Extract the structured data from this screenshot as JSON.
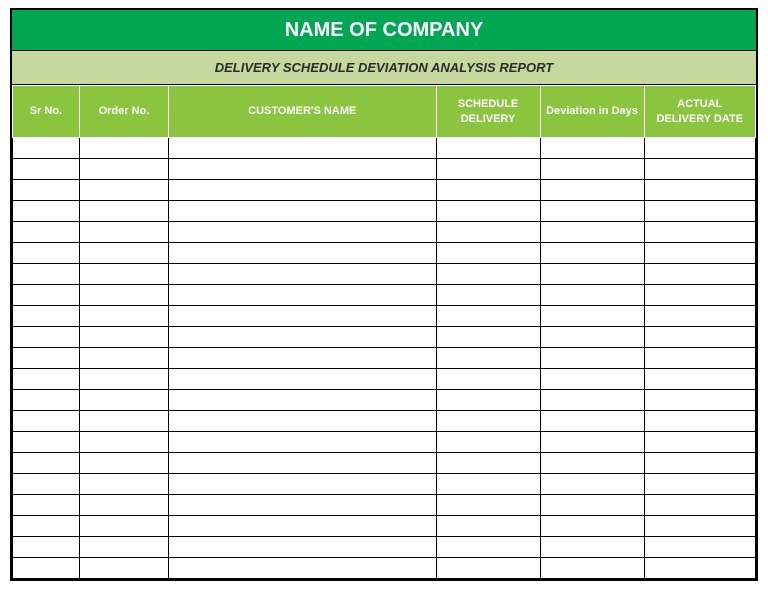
{
  "title": "NAME OF COMPANY",
  "subtitle": "DELIVERY SCHEDULE DEVIATION ANALYSIS REPORT",
  "headers": {
    "sr": "Sr No.",
    "order": "Order No.",
    "customer": "CUSTOMER'S NAME",
    "schedule": "SCHEDULE DELIVERY",
    "deviation": "Deviation in Days",
    "actual": "ACTUAL DELIVERY DATE"
  },
  "rows": [
    {
      "sr": "",
      "order": "",
      "customer": "",
      "schedule": "",
      "deviation": "",
      "actual": ""
    },
    {
      "sr": "",
      "order": "",
      "customer": "",
      "schedule": "",
      "deviation": "",
      "actual": ""
    },
    {
      "sr": "",
      "order": "",
      "customer": "",
      "schedule": "",
      "deviation": "",
      "actual": ""
    },
    {
      "sr": "",
      "order": "",
      "customer": "",
      "schedule": "",
      "deviation": "",
      "actual": ""
    },
    {
      "sr": "",
      "order": "",
      "customer": "",
      "schedule": "",
      "deviation": "",
      "actual": ""
    },
    {
      "sr": "",
      "order": "",
      "customer": "",
      "schedule": "",
      "deviation": "",
      "actual": ""
    },
    {
      "sr": "",
      "order": "",
      "customer": "",
      "schedule": "",
      "deviation": "",
      "actual": ""
    },
    {
      "sr": "",
      "order": "",
      "customer": "",
      "schedule": "",
      "deviation": "",
      "actual": ""
    },
    {
      "sr": "",
      "order": "",
      "customer": "",
      "schedule": "",
      "deviation": "",
      "actual": ""
    },
    {
      "sr": "",
      "order": "",
      "customer": "",
      "schedule": "",
      "deviation": "",
      "actual": ""
    },
    {
      "sr": "",
      "order": "",
      "customer": "",
      "schedule": "",
      "deviation": "",
      "actual": ""
    },
    {
      "sr": "",
      "order": "",
      "customer": "",
      "schedule": "",
      "deviation": "",
      "actual": ""
    },
    {
      "sr": "",
      "order": "",
      "customer": "",
      "schedule": "",
      "deviation": "",
      "actual": ""
    },
    {
      "sr": "",
      "order": "",
      "customer": "",
      "schedule": "",
      "deviation": "",
      "actual": ""
    },
    {
      "sr": "",
      "order": "",
      "customer": "",
      "schedule": "",
      "deviation": "",
      "actual": ""
    },
    {
      "sr": "",
      "order": "",
      "customer": "",
      "schedule": "",
      "deviation": "",
      "actual": ""
    },
    {
      "sr": "",
      "order": "",
      "customer": "",
      "schedule": "",
      "deviation": "",
      "actual": ""
    },
    {
      "sr": "",
      "order": "",
      "customer": "",
      "schedule": "",
      "deviation": "",
      "actual": ""
    },
    {
      "sr": "",
      "order": "",
      "customer": "",
      "schedule": "",
      "deviation": "",
      "actual": ""
    },
    {
      "sr": "",
      "order": "",
      "customer": "",
      "schedule": "",
      "deviation": "",
      "actual": ""
    },
    {
      "sr": "",
      "order": "",
      "customer": "",
      "schedule": "",
      "deviation": "",
      "actual": ""
    }
  ]
}
